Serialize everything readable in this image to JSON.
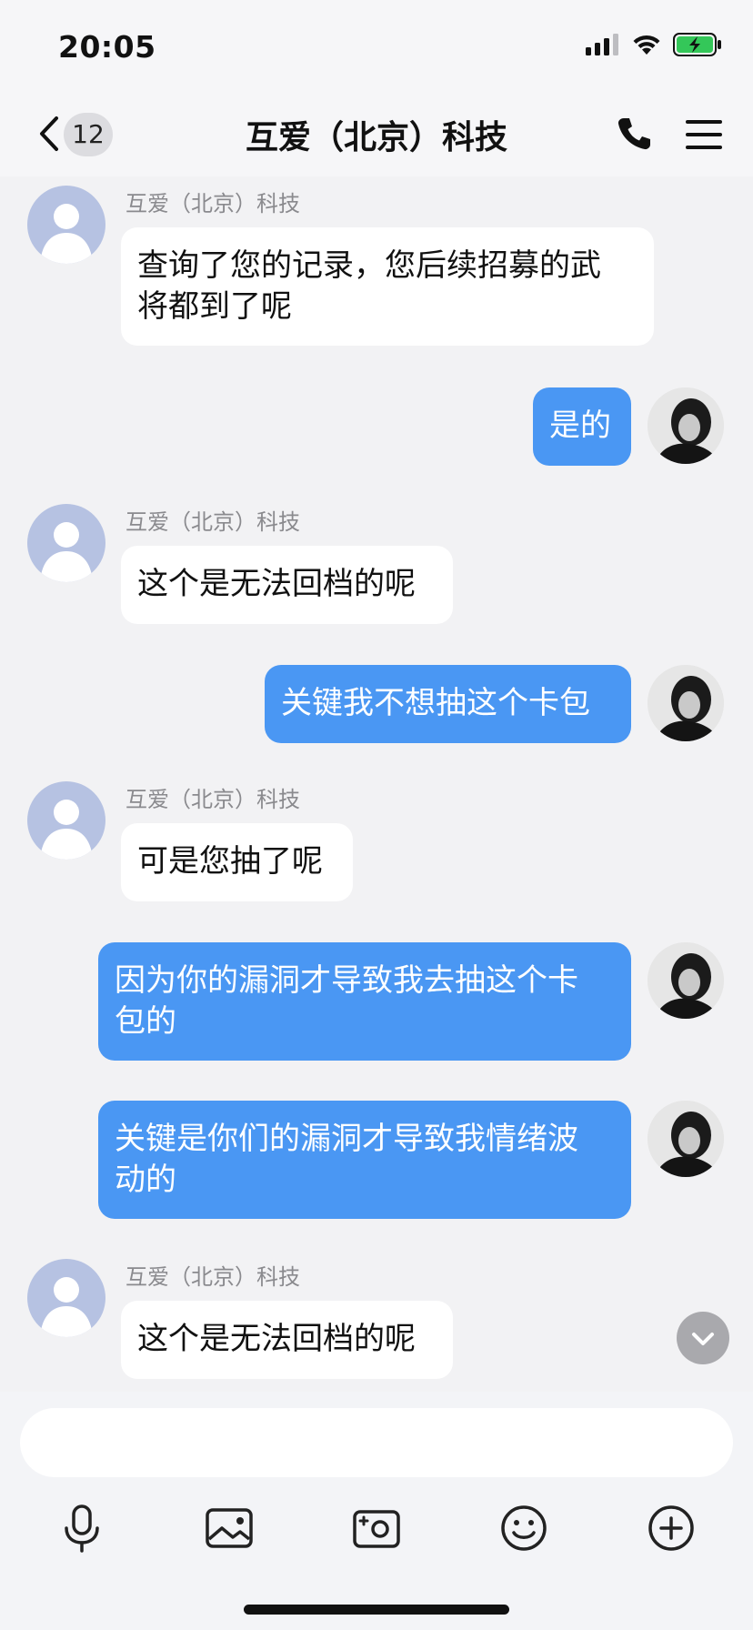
{
  "status_bar": {
    "time": "20:05",
    "battery_color": "#34c759"
  },
  "header": {
    "back_badge": "12",
    "title": "互爱（北京）科技"
  },
  "messages": [
    {
      "side": "left",
      "sender": "互爱（北京）科技",
      "lines": [
        "查询了您的记录，您后续招募的武",
        "将都到了呢"
      ]
    },
    {
      "side": "right",
      "lines": [
        "是的"
      ]
    },
    {
      "side": "left",
      "sender": "互爱（北京）科技",
      "lines": [
        "这个是无法回档的呢"
      ]
    },
    {
      "side": "right",
      "lines": [
        "关键我不想抽这个卡包"
      ]
    },
    {
      "side": "left",
      "sender": "互爱（北京）科技",
      "lines": [
        "可是您抽了呢"
      ]
    },
    {
      "side": "right",
      "lines": [
        "因为你的漏洞才导致我去抽这个卡",
        "包的"
      ]
    },
    {
      "side": "right",
      "lines": [
        "关键是你们的漏洞才导致我情绪波",
        "动的"
      ]
    },
    {
      "side": "left",
      "sender": "互爱（北京）科技",
      "lines": [
        "这个是无法回档的呢"
      ]
    }
  ],
  "input": {
    "placeholder": ""
  },
  "toolbar": [
    "microphone-icon",
    "image-icon",
    "camera-icon",
    "emoji-icon",
    "plus-icon"
  ],
  "colors": {
    "accent": "#4a97f3",
    "bubble_left": "#ffffff",
    "background": "#f2f2f4"
  }
}
